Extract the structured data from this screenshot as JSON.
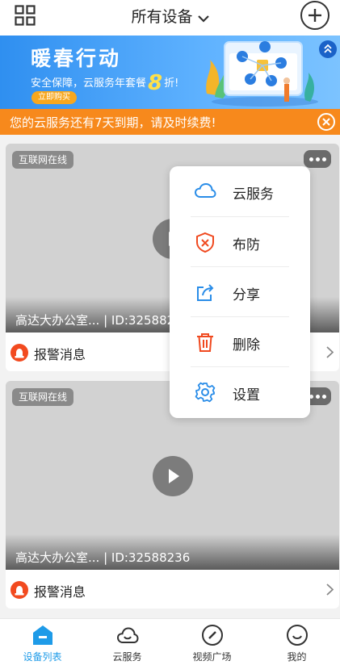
{
  "header": {
    "title": "所有设备"
  },
  "banner": {
    "title": "暖春行动",
    "subtitle_prefix": "安全保障，云服务年套餐",
    "discount": "8",
    "subtitle_suffix": "折!",
    "buy_label": "立即购买"
  },
  "notice": {
    "text": "您的云服务还有7天到期，请及时续费!"
  },
  "devices": [
    {
      "status": "互联网在线",
      "name": "高达大办公室... | ID:3258823",
      "alarm_label": "报警消息"
    },
    {
      "status": "互联网在线",
      "name": "高达大办公室... | ID:32588236",
      "alarm_label": "报警消息"
    }
  ],
  "menu": {
    "items": [
      {
        "label": "云服务",
        "icon": "cloud-icon"
      },
      {
        "label": "布防",
        "icon": "shield-x-icon"
      },
      {
        "label": "分享",
        "icon": "share-icon"
      },
      {
        "label": "删除",
        "icon": "trash-icon"
      },
      {
        "label": "设置",
        "icon": "gear-icon"
      }
    ]
  },
  "tabbar": {
    "items": [
      {
        "label": "设备列表",
        "icon": "device-list-icon",
        "active": true
      },
      {
        "label": "云服务",
        "icon": "cloud-service-icon",
        "active": false
      },
      {
        "label": "视频广场",
        "icon": "compass-icon",
        "active": false
      },
      {
        "label": "我的",
        "icon": "smile-icon",
        "active": false
      }
    ]
  },
  "colors": {
    "accent": "#1e9be8",
    "notice": "#f7891c",
    "alarm": "#f24a1f",
    "menu_icon_blue": "#2a8de8",
    "menu_icon_red": "#f0491f"
  }
}
